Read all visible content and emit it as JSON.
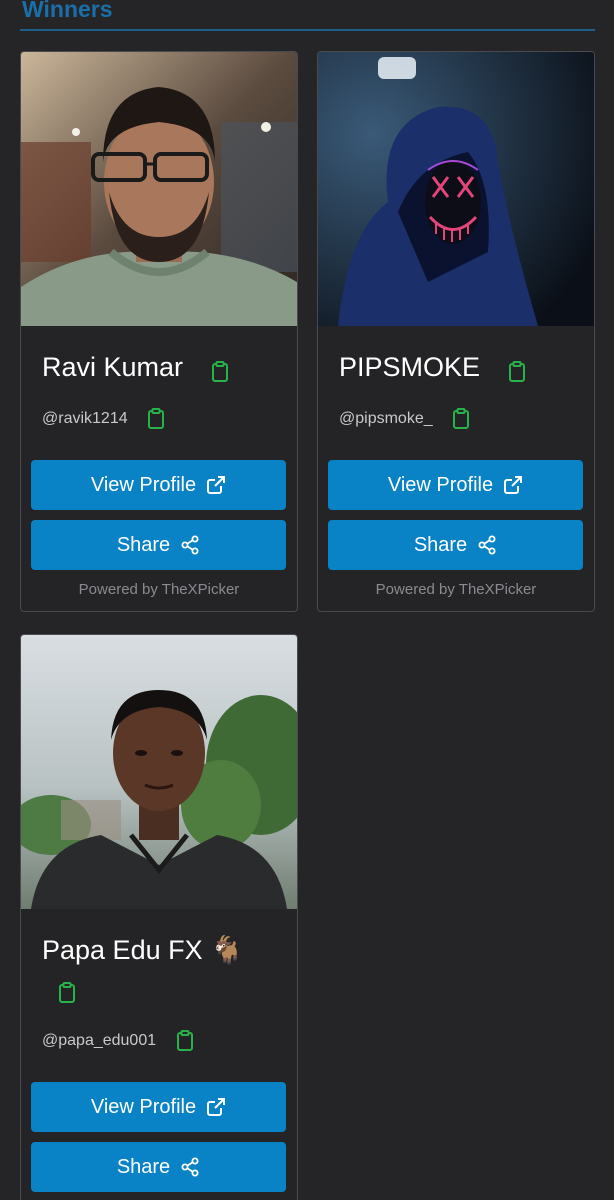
{
  "section": {
    "title": "Winners"
  },
  "cards": [
    {
      "name": "Ravi Kumar",
      "handle": "@ravik1214",
      "view_label": "View Profile",
      "share_label": "Share",
      "powered": "Powered by TheXPicker"
    },
    {
      "name": "PIPSMOKE",
      "handle": "@pipsmoke_",
      "view_label": "View Profile",
      "share_label": "Share",
      "powered": "Powered by TheXPicker"
    },
    {
      "name": "Papa Edu FX 🐐",
      "handle": "@papa_edu001",
      "view_label": "View Profile",
      "share_label": "Share"
    }
  ],
  "icons": {
    "copy": "clipboard-icon",
    "view": "external-link-icon",
    "share": "share-icon"
  },
  "colors": {
    "background": "#252527",
    "card_border": "#4a4b50",
    "button": "#0a82c6",
    "clipboard": "#27b24a",
    "title": "#1b6fa8"
  }
}
